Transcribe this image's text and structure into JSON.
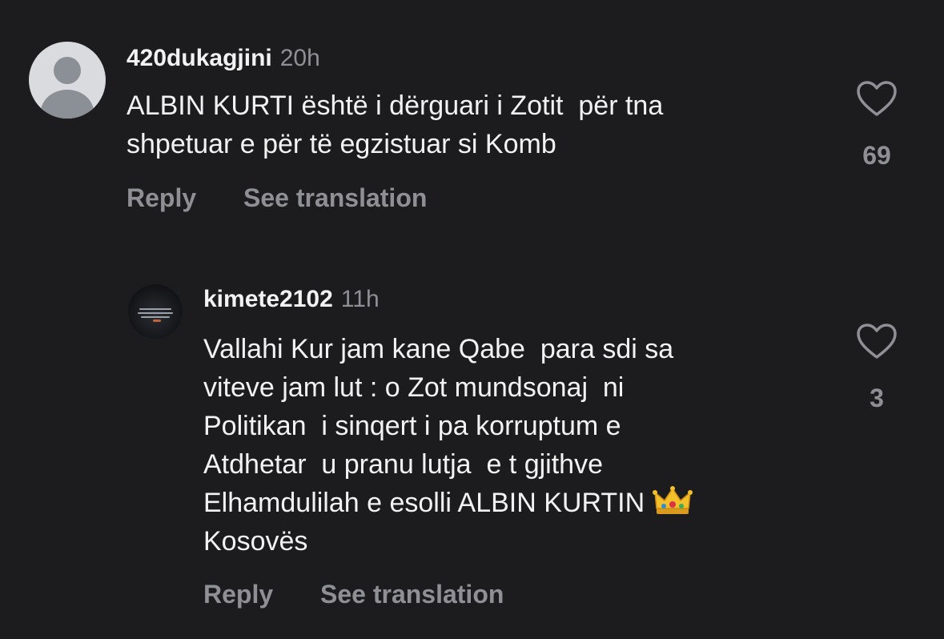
{
  "comments": [
    {
      "username": "420dukagjini",
      "time": "20h",
      "text": "ALBIN KURTI është i dërguari i Zotit  për tna\nshpetuar e për të egzistuar si Komb",
      "likes": "69",
      "reply_label": "Reply",
      "translate_label": "See translation",
      "avatar": "default-avatar-icon"
    },
    {
      "username": "kimete2102",
      "time": "11h",
      "text_main": "Vallahi Kur jam kane Qabe  para sdi sa\nviteve jam lut : o Zot mundsonaj  ni\nPolitikan  i sinqert i pa korruptum e\nAtdhetar  u pranu lutja  e t gjithve\nElhamdulilah e esolli ALBIN KURTIN ",
      "text_emoji": "crown-emoji",
      "text_end": "\nKosovës",
      "likes": "3",
      "reply_label": "Reply",
      "translate_label": "See translation",
      "avatar": "photo-avatar"
    }
  ],
  "colors": {
    "background": "#1c1c1f",
    "text": "#f2f2f2",
    "muted": "#8e9096"
  }
}
